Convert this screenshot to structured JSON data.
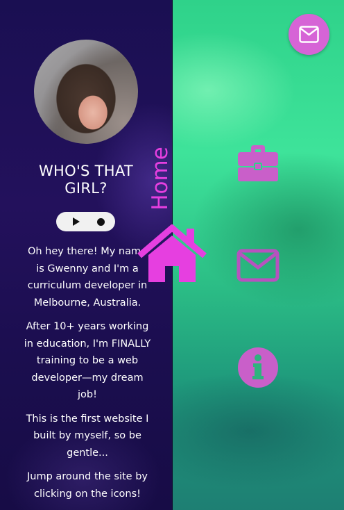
{
  "profile": {
    "title": "WHO'S THAT GIRL?",
    "bio": [
      "Oh hey there! My name is Gwenny and I'm a curriculum developer in Melbourne, Australia.",
      "After 10+ years working in education, I'm FINALLY training to be a web developer—my dream job!",
      "This is the first website I built by myself, so be gentle...",
      "Jump around the site by clicking on the icons!"
    ]
  },
  "nav": {
    "home_label": "Home",
    "items": [
      {
        "icon": "briefcase-icon"
      },
      {
        "icon": "envelope-icon"
      },
      {
        "icon": "info-icon"
      }
    ]
  },
  "colors": {
    "accent": "#e63fe0",
    "nav_icon": "#c95fc9",
    "fab": "#d664d6",
    "panel": "#1b0f52",
    "background": "#3ee39a"
  }
}
